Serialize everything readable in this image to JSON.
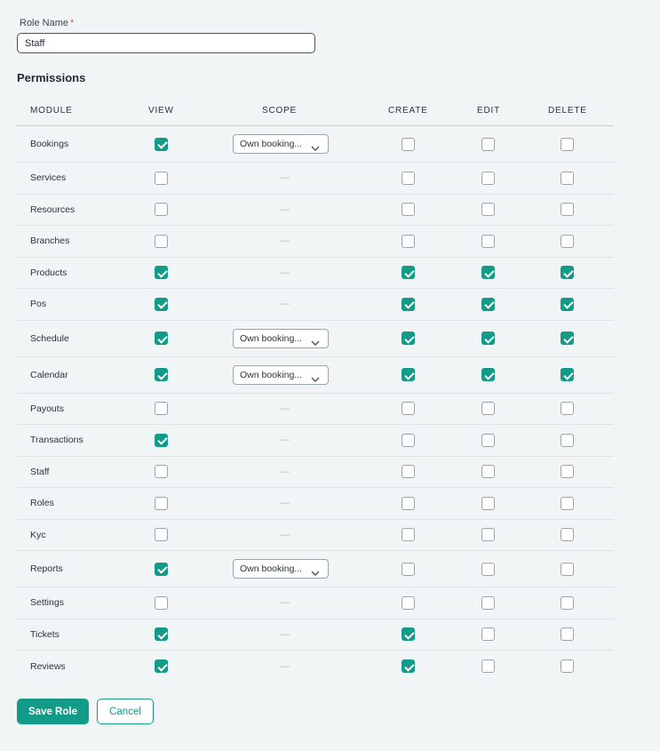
{
  "form": {
    "role_name_label": "Role Name",
    "required_mark": "*",
    "role_name_value": "Staff",
    "permissions_title": "Permissions"
  },
  "table": {
    "headers": {
      "module": "MODULE",
      "view": "VIEW",
      "scope": "SCOPE",
      "create": "CREATE",
      "edit": "EDIT",
      "delete": "DELETE"
    },
    "rows": [
      {
        "module": "Bookings",
        "view": true,
        "scope": "Own booking...",
        "create": false,
        "edit": false,
        "delete": false
      },
      {
        "module": "Services",
        "view": false,
        "scope": "—",
        "create": false,
        "edit": false,
        "delete": false
      },
      {
        "module": "Resources",
        "view": false,
        "scope": "—",
        "create": false,
        "edit": false,
        "delete": false
      },
      {
        "module": "Branches",
        "view": false,
        "scope": "—",
        "create": false,
        "edit": false,
        "delete": false
      },
      {
        "module": "Products",
        "view": true,
        "scope": "—",
        "create": true,
        "edit": true,
        "delete": true
      },
      {
        "module": "Pos",
        "view": true,
        "scope": "—",
        "create": true,
        "edit": true,
        "delete": true
      },
      {
        "module": "Schedule",
        "view": true,
        "scope": "Own booking...",
        "create": true,
        "edit": true,
        "delete": true
      },
      {
        "module": "Calendar",
        "view": true,
        "scope": "Own booking...",
        "create": true,
        "edit": true,
        "delete": true
      },
      {
        "module": "Payouts",
        "view": false,
        "scope": "—",
        "create": false,
        "edit": false,
        "delete": false
      },
      {
        "module": "Transactions",
        "view": true,
        "scope": "—",
        "create": false,
        "edit": false,
        "delete": false
      },
      {
        "module": "Staff",
        "view": false,
        "scope": "—",
        "create": false,
        "edit": false,
        "delete": false
      },
      {
        "module": "Roles",
        "view": false,
        "scope": "—",
        "create": false,
        "edit": false,
        "delete": false
      },
      {
        "module": "Kyc",
        "view": false,
        "scope": "—",
        "create": false,
        "edit": false,
        "delete": false
      },
      {
        "module": "Reports",
        "view": true,
        "scope": "Own booking...",
        "create": false,
        "edit": false,
        "delete": false
      },
      {
        "module": "Settings",
        "view": false,
        "scope": "—",
        "create": false,
        "edit": false,
        "delete": false
      },
      {
        "module": "Tickets",
        "view": true,
        "scope": "—",
        "create": true,
        "edit": false,
        "delete": false
      },
      {
        "module": "Reviews",
        "view": true,
        "scope": "—",
        "create": true,
        "edit": false,
        "delete": false
      }
    ]
  },
  "actions": {
    "save_label": "Save Role",
    "cancel_label": "Cancel"
  },
  "colors": {
    "accent": "#129b88",
    "background": "#f1f5f6",
    "required": "#d9534f"
  },
  "icons": {
    "select_chevron": "chevron-down-icon",
    "checkbox_check": "check-icon"
  }
}
